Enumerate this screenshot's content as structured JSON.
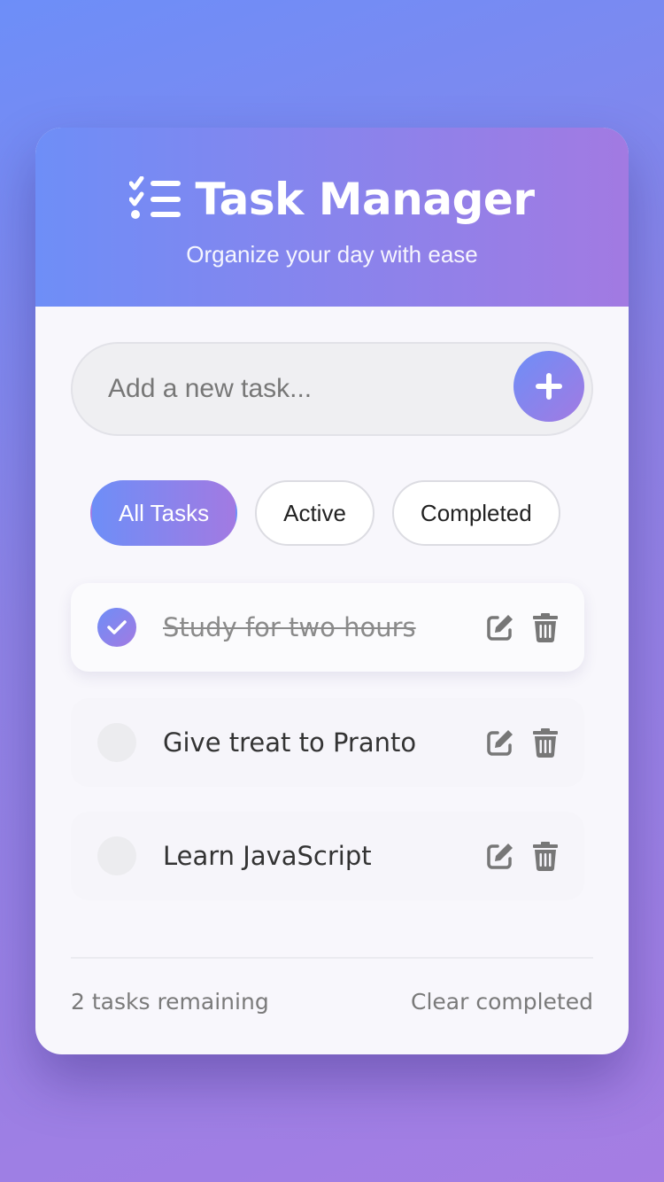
{
  "header": {
    "title": "Task Manager",
    "subtitle": "Organize your day with ease",
    "icon": "list-check-icon"
  },
  "add_task": {
    "placeholder": "Add a new task...",
    "value": "",
    "button_icon": "plus-icon"
  },
  "filters": [
    {
      "label": "All Tasks",
      "active": true
    },
    {
      "label": "Active",
      "active": false
    },
    {
      "label": "Completed",
      "active": false
    }
  ],
  "tasks": [
    {
      "text": "Study for two hours",
      "completed": true
    },
    {
      "text": "Give treat to Pranto",
      "completed": false
    },
    {
      "text": "Learn JavaScript",
      "completed": false
    }
  ],
  "footer": {
    "remaining": "2 tasks remaining",
    "clear": "Clear completed"
  },
  "colors": {
    "accent_start": "#6e8ef7",
    "accent_end": "#a27ae2",
    "icon_gray": "#777777"
  }
}
